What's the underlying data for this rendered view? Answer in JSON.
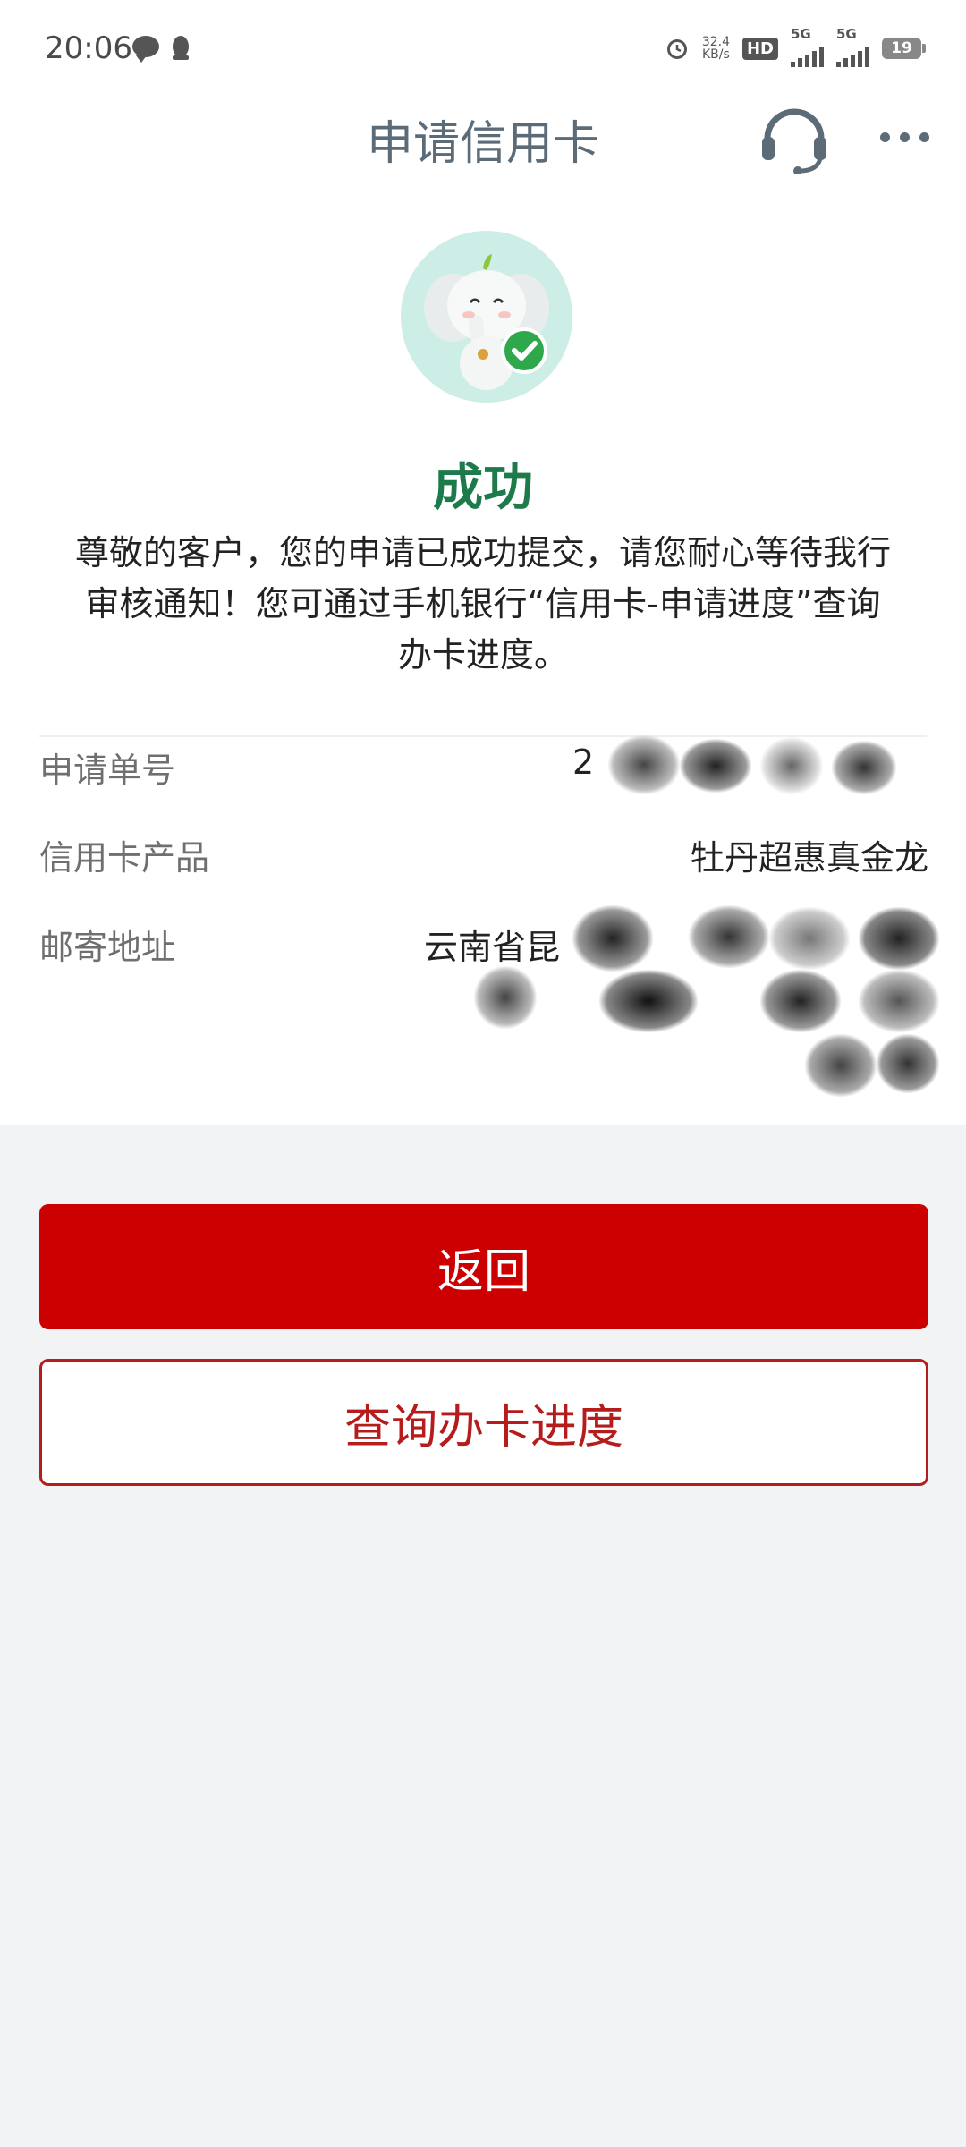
{
  "status_bar": {
    "time": "20:06",
    "net_speed_value": "32.4",
    "net_speed_unit": "KB/s",
    "hd_label": "HD",
    "signal_1_label": "5G",
    "signal_2_label": "5G",
    "battery": "19"
  },
  "header": {
    "title": "申请信用卡",
    "icons": [
      "headset-icon",
      "more-icon"
    ]
  },
  "result": {
    "status": "成功",
    "message": "尊敬的客户，您的申请已成功提交，请您耐心等待我行审核通知！您可通过手机银行“信用卡-申请进度”查询办卡进度。"
  },
  "details": [
    {
      "label": "申请单号",
      "value": "2"
    },
    {
      "label": "信用卡产品",
      "value": "牡丹超惠真金龙"
    },
    {
      "label": "邮寄地址",
      "value": "云南省昆"
    }
  ],
  "actions": {
    "back_label": "返回",
    "query_label": "查询办卡进度"
  },
  "colors": {
    "accent_red": "#cc0000",
    "success_green": "#1d7a4b",
    "header_gray": "#5c6b78"
  }
}
